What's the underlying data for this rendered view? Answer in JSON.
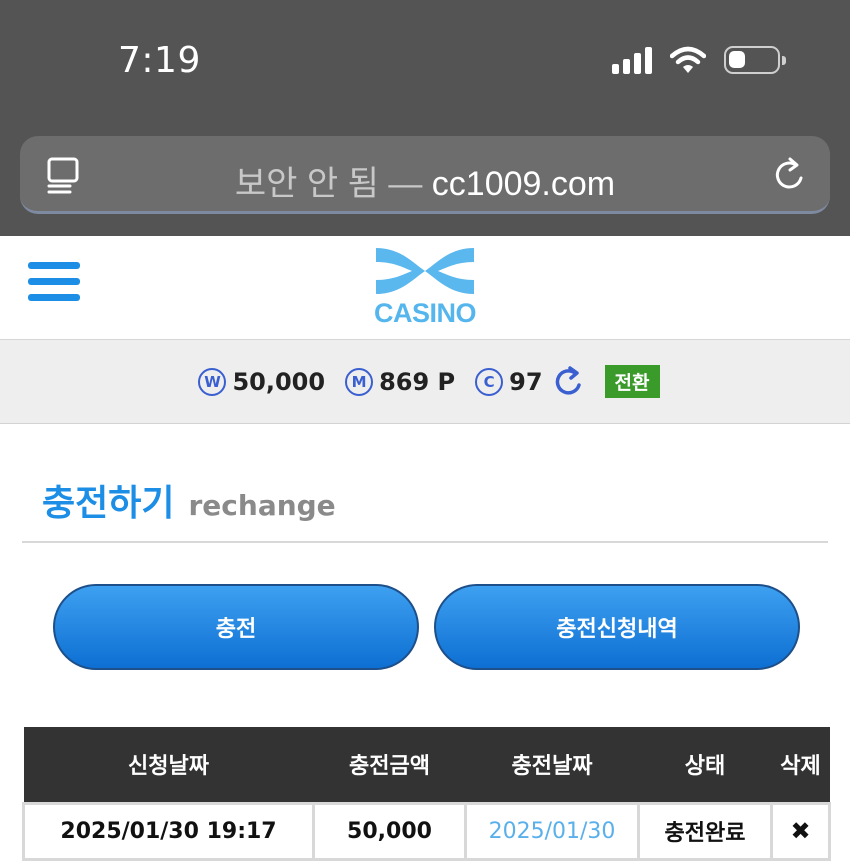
{
  "status_bar": {
    "time": "7:19"
  },
  "browser": {
    "secure_label": "보안 안 됨",
    "separator": "—",
    "domain": "cc1009.com"
  },
  "header": {
    "logo_text": "CASINO"
  },
  "balances": {
    "won": {
      "symbol": "W",
      "value": "50,000"
    },
    "mileage": {
      "symbol": "M",
      "value": "869 P"
    },
    "coin": {
      "symbol": "C",
      "value": "97"
    },
    "convert_label": "전환"
  },
  "page": {
    "title": "충전하기",
    "subtitle": "rechange"
  },
  "buttons": {
    "charge_label": "충전",
    "history_label": "충전신청내역"
  },
  "table": {
    "headers": [
      "신청날짜",
      "충전금액",
      "충전날짜",
      "상태",
      "삭제"
    ],
    "rows": [
      {
        "request_date": "2025/01/30 19:17",
        "amount": "50,000",
        "charge_date": "2025/01/30",
        "status": "충전완료",
        "delete": "✖"
      }
    ]
  },
  "colors": {
    "accent": "#1d8ee6",
    "convert_button": "#3a9b2a",
    "coin_icon": "#3a5fd0",
    "table_header": "#333333"
  }
}
